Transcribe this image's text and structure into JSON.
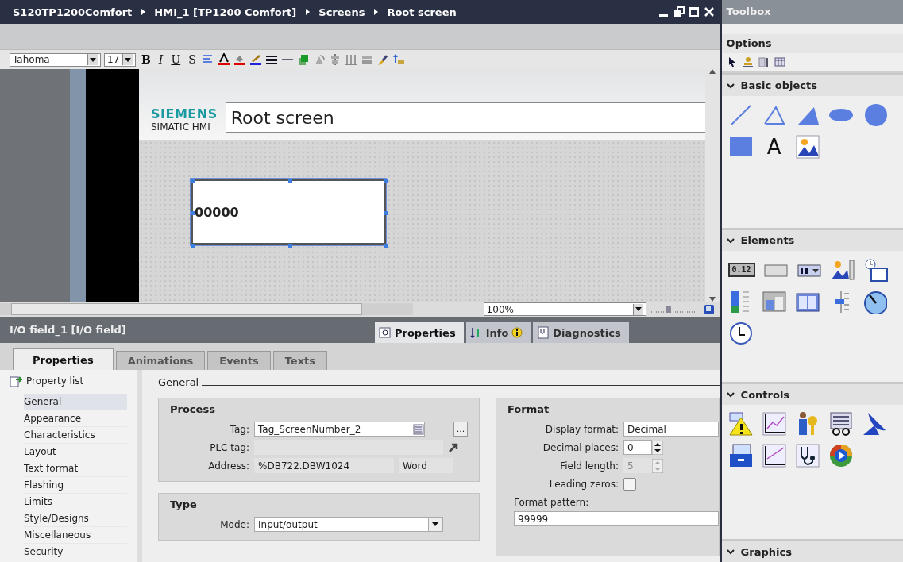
{
  "title_bar": {
    "breadcrumb": [
      "S120TP1200Comfort",
      "HMI_1 [TP1200 Comfort]",
      "Screens",
      "Root screen"
    ]
  },
  "format_toolbar": {
    "font": "Tahoma",
    "size": "17",
    "style_buttons": [
      {
        "label": "B",
        "kind": "bold"
      },
      {
        "label": "I",
        "kind": "italic"
      },
      {
        "label": "U",
        "kind": "underline"
      },
      {
        "label": "S",
        "kind": "strike"
      }
    ]
  },
  "screen": {
    "brand": "SIEMENS",
    "product": "SIMATIC HMI",
    "title": "Root screen",
    "io_field": {
      "value": "00000",
      "selected": true
    }
  },
  "view_bar": {
    "zoom": "100%",
    "zoom_slider": {
      "level": 0.35
    }
  },
  "inspector": {
    "title": "I/O field_1 [I/O field]",
    "view_tabs": [
      {
        "label": "Properties",
        "kind": "properties",
        "selected": true
      },
      {
        "label": "Info",
        "kind": "info",
        "selected": false
      },
      {
        "label": "Diagnostics",
        "kind": "diagnostics",
        "selected": false
      }
    ],
    "tabs": [
      {
        "label": "Properties",
        "selected": true
      },
      {
        "label": "Animations",
        "selected": false
      },
      {
        "label": "Events",
        "selected": false
      },
      {
        "label": "Texts",
        "selected": false
      }
    ],
    "property_list": {
      "title": "Property list",
      "items": [
        {
          "label": "General",
          "selected": true
        },
        {
          "label": "Appearance",
          "selected": false
        },
        {
          "label": "Characteristics",
          "selected": false
        },
        {
          "label": "Layout",
          "selected": false
        },
        {
          "label": "Text format",
          "selected": false
        },
        {
          "label": "Flashing",
          "selected": false
        },
        {
          "label": "Limits",
          "selected": false
        },
        {
          "label": "Style/Designs",
          "selected": false
        },
        {
          "label": "Miscellaneous",
          "selected": false
        },
        {
          "label": "Security",
          "selected": false
        }
      ]
    },
    "section_title": "General",
    "process": {
      "title": "Process",
      "tag_label": "Tag:",
      "tag": "Tag_ScreenNumber_2",
      "browse": "...",
      "plc_label": "PLC tag:",
      "address_label": "Address:",
      "address": "%DB722.DBW1024",
      "data_type": "Word"
    },
    "type": {
      "title": "Type",
      "mode_label": "Mode:",
      "mode": "Input/output"
    },
    "format": {
      "title": "Format",
      "rows": [
        {
          "label": "Display format:",
          "kind": "select",
          "value": "Decimal"
        },
        {
          "label": "Decimal places:",
          "kind": "spinner",
          "value": "0",
          "disabled": false
        },
        {
          "label": "Field length:",
          "kind": "spinner",
          "value": "5",
          "disabled": true
        },
        {
          "label": "Leading zeros:",
          "kind": "checkbox",
          "checked": false
        }
      ],
      "pattern_label": "Format pattern:",
      "pattern": "99999"
    }
  },
  "toolbox": {
    "title": "Toolbox",
    "options": "Options",
    "sections": [
      {
        "title": "Basic objects",
        "expanded": true,
        "items": [
          {
            "kind": "line"
          },
          {
            "kind": "polyline"
          },
          {
            "kind": "polygon"
          },
          {
            "kind": "ellipse"
          },
          {
            "kind": "circle"
          },
          {
            "kind": "rectangle"
          },
          {
            "kind": "text",
            "label": "A"
          },
          {
            "kind": "graphic"
          }
        ]
      },
      {
        "title": "Elements",
        "expanded": true,
        "items": [
          {
            "kind": "io",
            "label": "0.12"
          },
          {
            "kind": "button"
          },
          {
            "kind": "symbolic"
          },
          {
            "kind": "graphic-list"
          },
          {
            "kind": "date"
          },
          {
            "kind": "bar"
          },
          {
            "kind": "switch"
          },
          {
            "kind": "symbol-lib"
          },
          {
            "kind": "slider"
          },
          {
            "kind": "gauge"
          },
          {
            "kind": "clock"
          }
        ]
      },
      {
        "title": "Controls",
        "expanded": true,
        "items": [
          {
            "kind": "alarm"
          },
          {
            "kind": "trend"
          },
          {
            "kind": "user"
          },
          {
            "kind": "table"
          },
          {
            "kind": "dish"
          },
          {
            "kind": "recipe"
          },
          {
            "kind": "fx"
          },
          {
            "kind": "stethoscope"
          },
          {
            "kind": "media"
          }
        ]
      },
      {
        "title": "Graphics",
        "expanded": true
      }
    ]
  }
}
